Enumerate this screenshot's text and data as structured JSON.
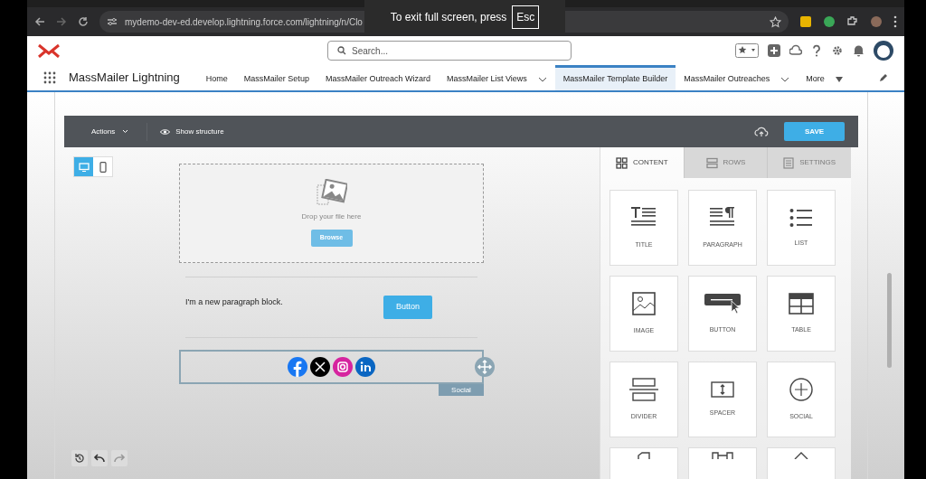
{
  "browser": {
    "url": "mydemo-dev-ed.develop.lightning.force.com/lightning/n/Clo",
    "fullscreen_notice": {
      "text": "To exit full screen, press",
      "key": "Esc"
    }
  },
  "app": {
    "search_placeholder": "Search...",
    "name": "MassMailer Lightning"
  },
  "nav": [
    {
      "label": "Home",
      "selected": false,
      "dropdown": false
    },
    {
      "label": "MassMailer Setup",
      "selected": false,
      "dropdown": false
    },
    {
      "label": "MassMailer Outreach Wizard",
      "selected": false,
      "dropdown": false
    },
    {
      "label": "MassMailer List Views",
      "selected": false,
      "dropdown": true
    },
    {
      "label": "MassMailer Template Builder",
      "selected": true,
      "dropdown": false
    },
    {
      "label": "MassMailer Outreaches",
      "selected": false,
      "dropdown": true
    },
    {
      "label": "More",
      "selected": false,
      "dropdown": true
    }
  ],
  "builder": {
    "actions": "Actions",
    "show_structure": "Show structure",
    "save": "SAVE",
    "devices": [
      {
        "kind": "desktop",
        "selected": true
      },
      {
        "kind": "mobile",
        "selected": false
      }
    ],
    "canvas": {
      "drop_text": "Drop your file here",
      "browse": "Browse",
      "paragraph": "I'm a new paragraph block.",
      "button": "Button",
      "social_label": "Social"
    },
    "tabs": [
      {
        "label": "CONTENT",
        "kind": "content",
        "selected": true
      },
      {
        "label": "ROWS",
        "kind": "rows",
        "selected": false
      },
      {
        "label": "SETTINGS",
        "kind": "settings",
        "selected": false
      }
    ],
    "tiles": [
      {
        "kind": "title",
        "label": "TITLE"
      },
      {
        "kind": "paragraph",
        "label": "PARAGRAPH"
      },
      {
        "kind": "list",
        "label": "LIST"
      },
      {
        "kind": "image",
        "label": "IMAGE"
      },
      {
        "kind": "button",
        "label": "BUTTON"
      },
      {
        "kind": "table",
        "label": "TABLE"
      },
      {
        "kind": "divider",
        "label": "DIVIDER"
      },
      {
        "kind": "spacer",
        "label": "SPACER"
      },
      {
        "kind": "social",
        "label": "SOCIAL"
      },
      {
        "kind": "partial_a"
      },
      {
        "kind": "partial_b"
      },
      {
        "kind": "partial_c"
      }
    ]
  }
}
